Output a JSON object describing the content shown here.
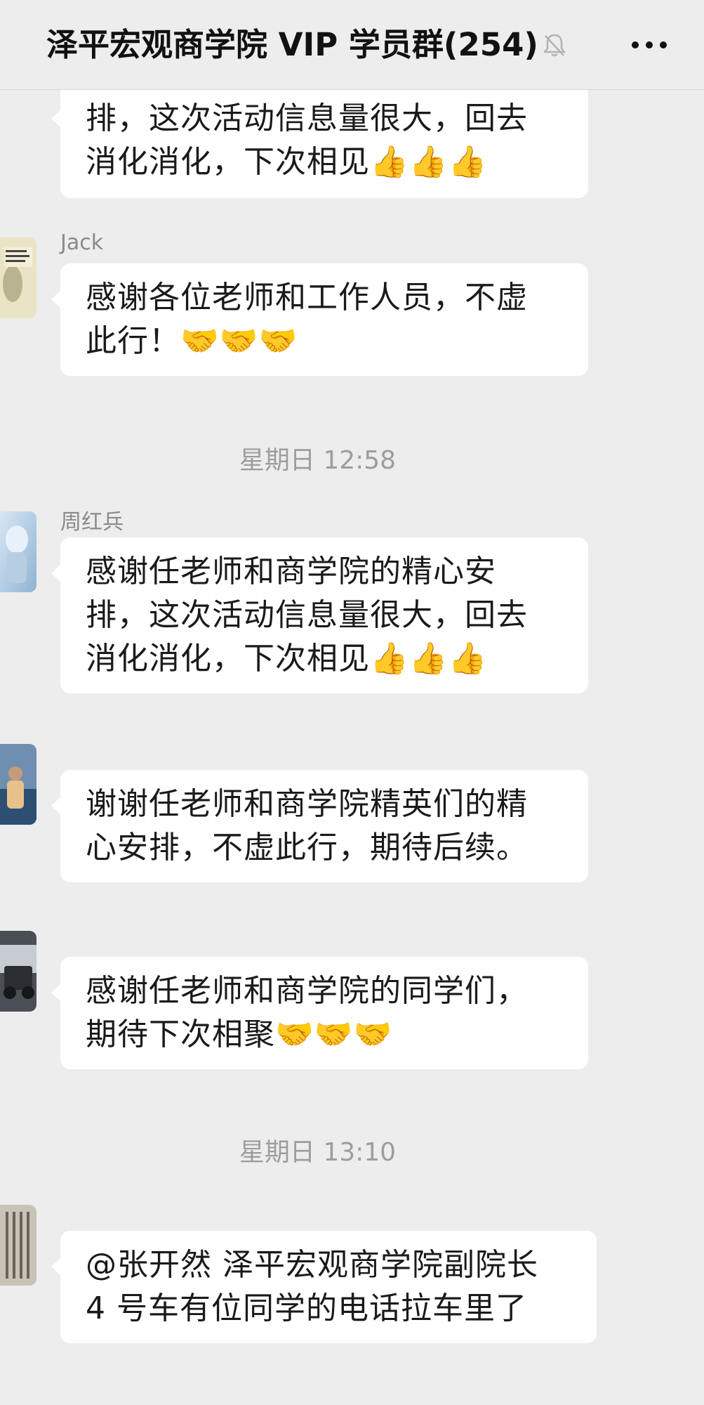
{
  "header": {
    "title": "泽平宏观商学院 VIP 学员群(254)",
    "mute_icon": "bell-muted-icon",
    "more_icon": "ellipsis-icon"
  },
  "messages": [
    {
      "sender": "",
      "lines": [
        "排，这次活动信息量很大，回去",
        "消化消化，下次相见👍👍👍"
      ]
    },
    {
      "sender": "Jack",
      "lines": [
        "感谢各位老师和工作人员，不虚",
        "此行！🤝🤝🤝"
      ]
    },
    {
      "sender": "周红兵",
      "lines": [
        "感谢任老师和商学院的精心安",
        "排，这次活动信息量很大，回去",
        "消化消化，下次相见👍👍👍"
      ]
    },
    {
      "sender": "",
      "lines": [
        "谢谢任老师和商学院精英们的精",
        "心安排，不虚此行，期待后续。"
      ]
    },
    {
      "sender": "",
      "lines": [
        " 感谢任老师和商学院的同学们，",
        "期待下次相聚🤝🤝🤝"
      ]
    },
    {
      "sender": "",
      "lines": [
        "@张开然 泽平宏观商学院副院长",
        " 4 号车有位同学的电话拉车里了"
      ]
    }
  ],
  "timestamps": [
    "星期日 12:58",
    "星期日 13:10"
  ],
  "colors": {
    "background": "#ededed",
    "bubble": "#ffffff",
    "timestamp": "#9d9d9d",
    "sender_name": "#8a8a8a"
  }
}
